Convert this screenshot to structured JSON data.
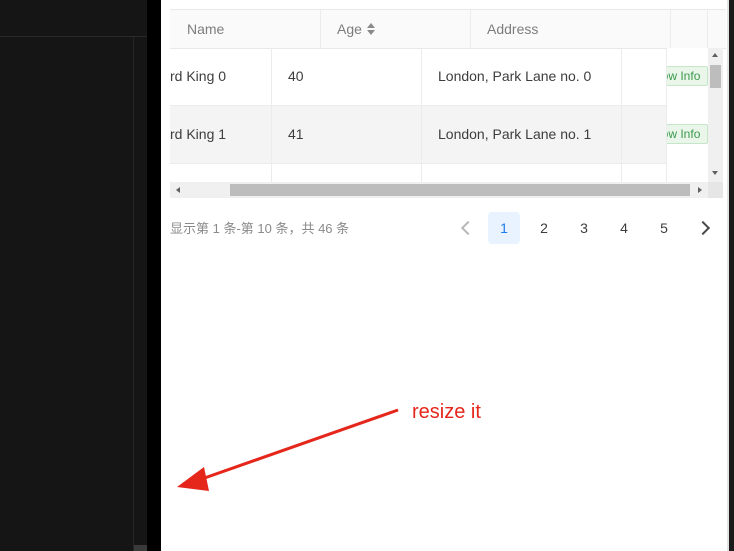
{
  "table": {
    "columns": [
      {
        "label": "Name"
      },
      {
        "label": "Age"
      },
      {
        "label": "Address"
      }
    ],
    "rows": [
      {
        "name": "rd King 0",
        "age": "40",
        "address": "London, Park Lane no. 0",
        "action": "Show Info"
      },
      {
        "name": "rd King 1",
        "age": "41",
        "address": "London, Park Lane no. 1",
        "action": "Show Info"
      }
    ]
  },
  "pagination": {
    "total_text": "显示第 1 条-第 10 条，共 46 条",
    "pages": [
      "1",
      "2",
      "3",
      "4",
      "5"
    ],
    "current": "1"
  },
  "annotation": {
    "text": "resize it",
    "color": "#e5261b"
  },
  "colors": {
    "tag_text": "#3a9a4c",
    "active_page": "#1f7ce8",
    "dark_panel": "#151515"
  },
  "icons": {
    "sort": "caret-up-down-icon",
    "prev": "chevron-left-icon",
    "next": "chevron-right-icon",
    "arrow": "red-arrow-icon",
    "handle": "resize-handle-icon"
  }
}
